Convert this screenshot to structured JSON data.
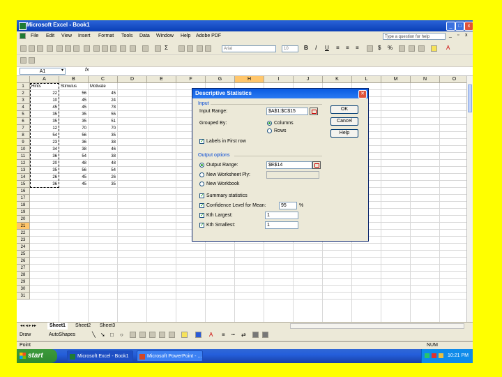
{
  "window": {
    "title": "Microsoft Excel - Book1"
  },
  "menu": {
    "items": [
      "File",
      "Edit",
      "View",
      "Insert",
      "Format",
      "Tools",
      "Data",
      "Window",
      "Help",
      "Adobe PDF"
    ],
    "help_placeholder": "Type a question for help"
  },
  "format_toolbar": {
    "font": "Arial",
    "size": "10"
  },
  "namebox": "A1",
  "fx": "fx",
  "columns": [
    "A",
    "B",
    "C",
    "D",
    "E",
    "F",
    "G",
    "H",
    "I",
    "J",
    "K",
    "L",
    "M",
    "N",
    "O"
  ],
  "highlight_column": "H",
  "highlight_row": "21",
  "rows": [
    "1",
    "2",
    "3",
    "4",
    "5",
    "6",
    "7",
    "8",
    "9",
    "10",
    "11",
    "12",
    "13",
    "14",
    "15",
    "16",
    "17",
    "18",
    "19",
    "20",
    "21",
    "22",
    "23",
    "24",
    "25",
    "26",
    "27",
    "28",
    "29",
    "30",
    "31"
  ],
  "table": {
    "headers": [
      "Hints",
      "Stimulus",
      "Motivate"
    ],
    "data": [
      [
        22,
        56,
        45
      ],
      [
        10,
        45,
        24
      ],
      [
        45,
        45,
        78
      ],
      [
        35,
        35,
        55
      ],
      [
        35,
        35,
        51
      ],
      [
        12,
        70,
        70
      ],
      [
        54,
        56,
        35
      ],
      [
        23,
        36,
        38
      ],
      [
        34,
        38,
        46
      ],
      [
        36,
        54,
        38
      ],
      [
        20,
        48,
        48
      ],
      [
        35,
        56,
        54
      ],
      [
        26,
        45,
        26
      ],
      [
        36,
        45,
        35
      ]
    ]
  },
  "dialog": {
    "title": "Descriptive Statistics",
    "input_header": "Input",
    "input_range_label": "Input Range:",
    "input_range_value": "$A$1:$C$15",
    "grouped_by_label": "Grouped By:",
    "columns_label": "Columns",
    "rows_label": "Rows",
    "labels_first_row": "Labels in First row",
    "output_header": "Output options",
    "output_range_label": "Output Range:",
    "output_range_value": "$E$14",
    "new_worksheet_label": "New Worksheet Ply:",
    "new_workbook_label": "New Workbook",
    "summary_label": "Summary statistics",
    "confidence_label": "Confidence Level for Mean:",
    "confidence_value": "95",
    "confidence_unit": "%",
    "kth_largest_label": "Kth Largest:",
    "kth_largest_value": "1",
    "kth_smallest_label": "Kth Smallest:",
    "kth_smallest_value": "1",
    "ok": "OK",
    "cancel": "Cancel",
    "help": "Help"
  },
  "sheet_tabs": [
    "Sheet1",
    "Sheet2",
    "Sheet3"
  ],
  "draw_toolbar": {
    "draw": "Draw",
    "autoshapes": "AutoShapes"
  },
  "status": {
    "left": "Point",
    "right": "NUM"
  },
  "taskbar": {
    "start": "start",
    "apps": [
      "Microsoft Excel - Book1",
      "Microsoft PowerPoint - ..."
    ],
    "clock": "10:21 PM"
  }
}
